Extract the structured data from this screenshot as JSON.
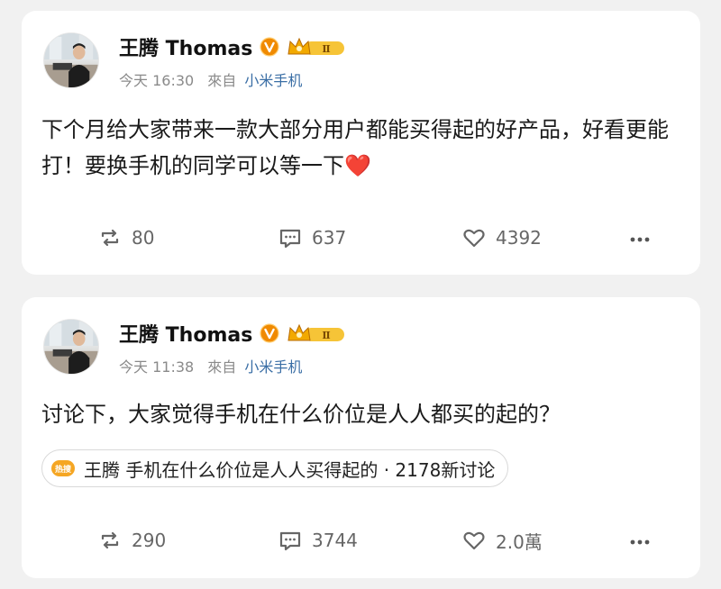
{
  "colors": {
    "background": "#f1f1f1",
    "card": "#ffffff",
    "source_link": "#3a6ea5",
    "heart": "#e0342c",
    "vip_badge": "#f08a00",
    "action_text": "#666666"
  },
  "posts": [
    {
      "author": "王腾 Thomas",
      "time": "今天 16:30",
      "from_label": "來自",
      "source": "小米手机",
      "text": "下个月给大家带来一款大部分用户都能买得起的好产品，好看更能打！要换手机的同学可以等一下",
      "emoji": "❤️",
      "reposts": "80",
      "comments": "637",
      "likes": "4392"
    },
    {
      "author": "王腾 Thomas",
      "time": "今天 11:38",
      "from_label": "來自",
      "source": "小米手机",
      "text": "讨论下，大家觉得手机在什么价位是人人都买的起的？",
      "topic": {
        "icon_label": "热搜",
        "text": "王腾  手机在什么价位是人人买得起的 · 2178新讨论"
      },
      "reposts": "290",
      "comments": "3744",
      "likes": "2.0萬"
    }
  ],
  "icons": {
    "verified": "verified-v-icon",
    "membership": "crown-level-icon",
    "repost": "repost-icon",
    "comment": "comment-icon",
    "like": "heart-outline-icon",
    "more": "more-dots-icon"
  }
}
